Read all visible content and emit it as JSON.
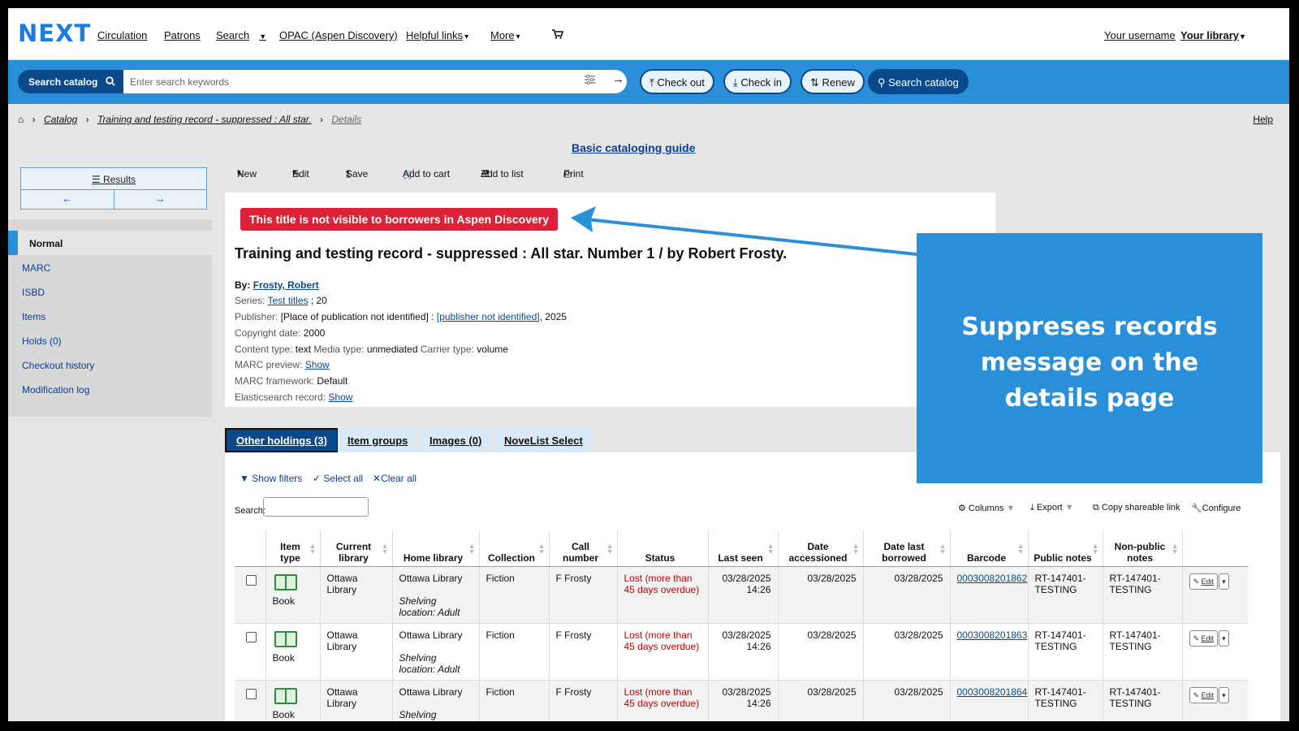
{
  "app": {
    "logo": "NEXT"
  },
  "nav": {
    "items": [
      "Circulation",
      "Patrons",
      "Search",
      "OPAC (Aspen Discovery)",
      "Helpful links",
      "More"
    ],
    "username": "Your username",
    "library": "Your library"
  },
  "search": {
    "button": "Search catalog",
    "placeholder": "Enter search keywords",
    "checkout": "Check out",
    "checkin": "Check in",
    "renew": "Renew",
    "search_catalog": "Search catalog"
  },
  "breadcrumb": [
    "Catalog",
    "Training and testing record - suppressed : All star.",
    "Details"
  ],
  "help": "Help",
  "guide": "Basic cataloging guide",
  "sidebar": {
    "results": "Results",
    "items": [
      "Normal",
      "MARC",
      "ISBD",
      "Items",
      "Holds (0)",
      "Checkout history",
      "Modification log"
    ]
  },
  "toolbar": {
    "new": "New",
    "edit": "Edit",
    "save": "Save",
    "add_to_cart": "Add to cart",
    "add_to_list": "Add to list",
    "print": "Print"
  },
  "record": {
    "warning": "This title is not visible to borrowers in Aspen Discovery",
    "title": "Training and testing record - suppressed : All star. Number 1 / by Robert Frosty.",
    "by_label": "By:",
    "author": "Frosty, Robert",
    "series_label": "Series:",
    "series_link": "Test titles",
    "series_num": "; 20",
    "publisher_label": "Publisher:",
    "publisher_place": "[Place of publication not identified] :",
    "publisher_link": "[publisher not identified]",
    "publisher_year": ", 2025",
    "copyright_label": "Copyright date:",
    "copyright": "2000",
    "content_label": "Content type:",
    "content": "text",
    "media_label": "Media type:",
    "media": "unmediated",
    "carrier_label": "Carrier type:",
    "carrier": "volume",
    "marc_preview_label": "MARC preview:",
    "marc_framework_label": "MARC framework:",
    "marc_framework": "Default",
    "es_label": "Elasticsearch record:",
    "show": "Show"
  },
  "callout": "Suppreses records message on the details page",
  "tabs": [
    "Other holdings (3)",
    "Item groups",
    "Images (0)",
    "NoveList Select"
  ],
  "filters": {
    "show": "Show filters",
    "select_all": "Select all",
    "clear_all": "Clear all",
    "search_label": "Search:"
  },
  "table_tools": {
    "columns": "Columns",
    "export": "Export",
    "copy": "Copy shareable link",
    "configure": "Configure"
  },
  "table": {
    "headers": [
      "Item type",
      "Current library",
      "Home library",
      "Collection",
      "Call number",
      "Status",
      "Last seen",
      "Date accessioned",
      "Date last borrowed",
      "Barcode",
      "Public notes",
      "Non-public notes"
    ],
    "rows": [
      {
        "type": "Book",
        "current": "Ottawa Library",
        "home": "Ottawa Library",
        "shelving": "Shelving location: Adult",
        "collection": "Fiction",
        "call": "F Frosty",
        "status": "Lost (more than 45 days overdue)",
        "seen_date": "03/28/2025",
        "seen_time": "14:26",
        "accessioned": "03/28/2025",
        "borrowed": "03/28/2025",
        "barcode": "0003008201862",
        "public": "RT-147401-TESTING",
        "nonpublic": "RT-147401-TESTING",
        "edit": "Edit"
      },
      {
        "type": "Book",
        "current": "Ottawa Library",
        "home": "Ottawa Library",
        "shelving": "Shelving location: Adult",
        "collection": "Fiction",
        "call": "F Frosty",
        "status": "Lost (more than 45 days overdue)",
        "seen_date": "03/28/2025",
        "seen_time": "14:26",
        "accessioned": "03/28/2025",
        "borrowed": "03/28/2025",
        "barcode": "0003008201863",
        "public": "RT-147401-TESTING",
        "nonpublic": "RT-147401-TESTING",
        "edit": "Edit"
      },
      {
        "type": "Book",
        "current": "Ottawa Library",
        "home": "Ottawa Library",
        "shelving": "Shelving location: Adult",
        "collection": "Fiction",
        "call": "F Frosty",
        "status": "Lost (more than 45 days overdue)",
        "seen_date": "03/28/2025",
        "seen_time": "14:26",
        "accessioned": "03/28/2025",
        "borrowed": "03/28/2025",
        "barcode": "0003008201864",
        "public": "RT-147401-TESTING",
        "nonpublic": "RT-147401-TESTING",
        "edit": "Edit"
      }
    ]
  },
  "colors": {
    "brand": "#1a7ce0",
    "bar": "#2a8fd9",
    "dark": "#0b4a8a",
    "warning": "#dc2238",
    "callout": "#2a8fd9",
    "lost": "#c00000"
  }
}
